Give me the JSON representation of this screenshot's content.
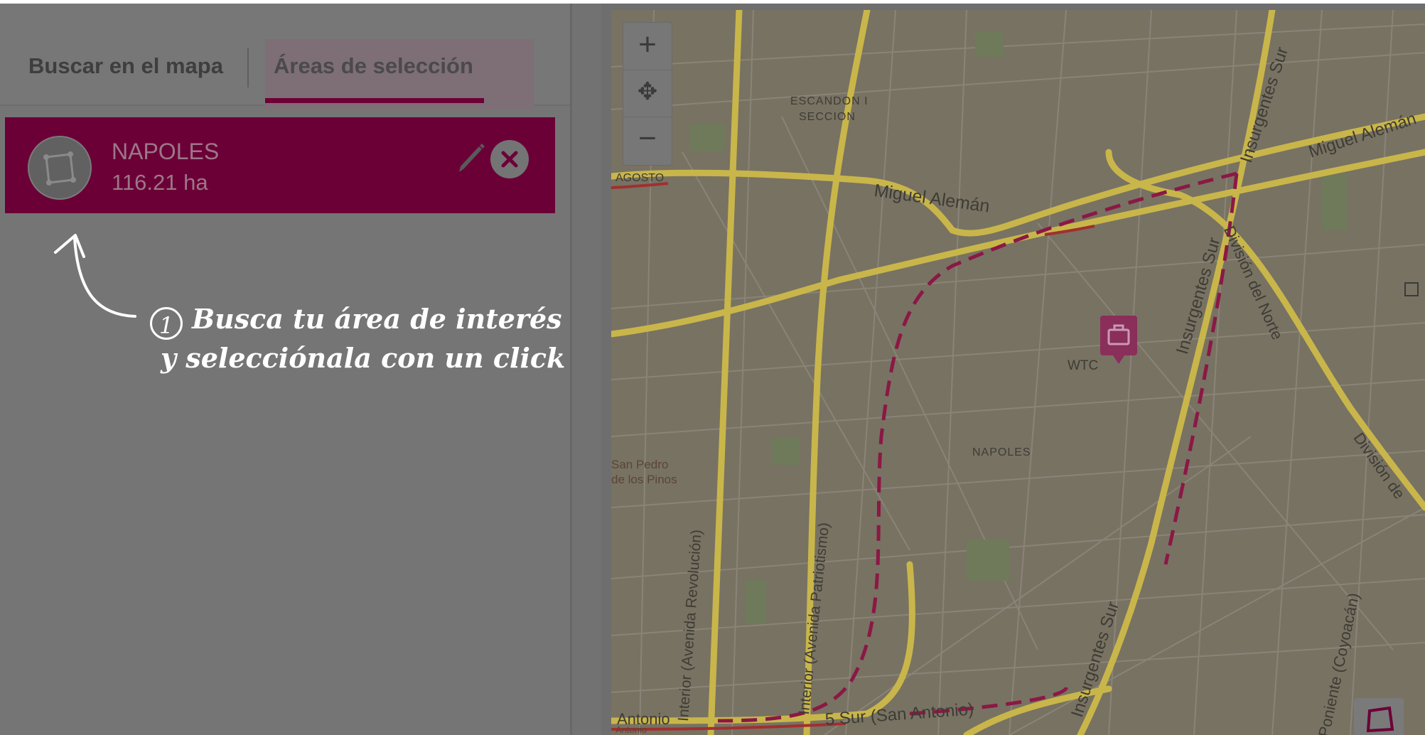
{
  "tabs": {
    "search_label": "Buscar en el mapa",
    "areas_label": "Áreas de selección"
  },
  "area_card": {
    "name": "NAPOLES",
    "size": "116.21 ha"
  },
  "hint": {
    "number": "1",
    "line1": "Busca tu área de interés",
    "line2": "y selecciónala con un click"
  },
  "map": {
    "labels": {
      "escandon": "ESCANDON I",
      "seccion": "SECCION",
      "agosto": "AGOSTO",
      "miguel_aleman": "Miguel Alemán",
      "miguel_aleman_right": "Miguel Alemán",
      "insurgentes_sur_top": "Insurgentes Sur",
      "insurgentes_sur_mid": "Insurgentes Sur",
      "insurgentes_sur_bottom": "Insurgentes Sur",
      "division_del_norte": "División del Norte",
      "division_right": "División de",
      "wtc": "WTC",
      "napoles": "NAPOLES",
      "san_pedro": "San Pedro",
      "de_los_pinos": "de los Pinos",
      "interior_revolucion": "Interior (Avenida Revolución)",
      "interior_patriotismo": "Interior (Avenida Patriotismo)",
      "sur_san_antonio": "5 Sur (San Antonio)",
      "antonio": "Antonio",
      "antonio_small": "Antonio",
      "poniente_coyoacan": "Poniente (Coyoacán)"
    },
    "zoom_in": "+",
    "pan": "✥",
    "zoom_out": "−",
    "colors": {
      "map_bg": "#787263",
      "road": "#c9b64a",
      "route": "#8b1845",
      "accent": "#6b0037"
    }
  }
}
